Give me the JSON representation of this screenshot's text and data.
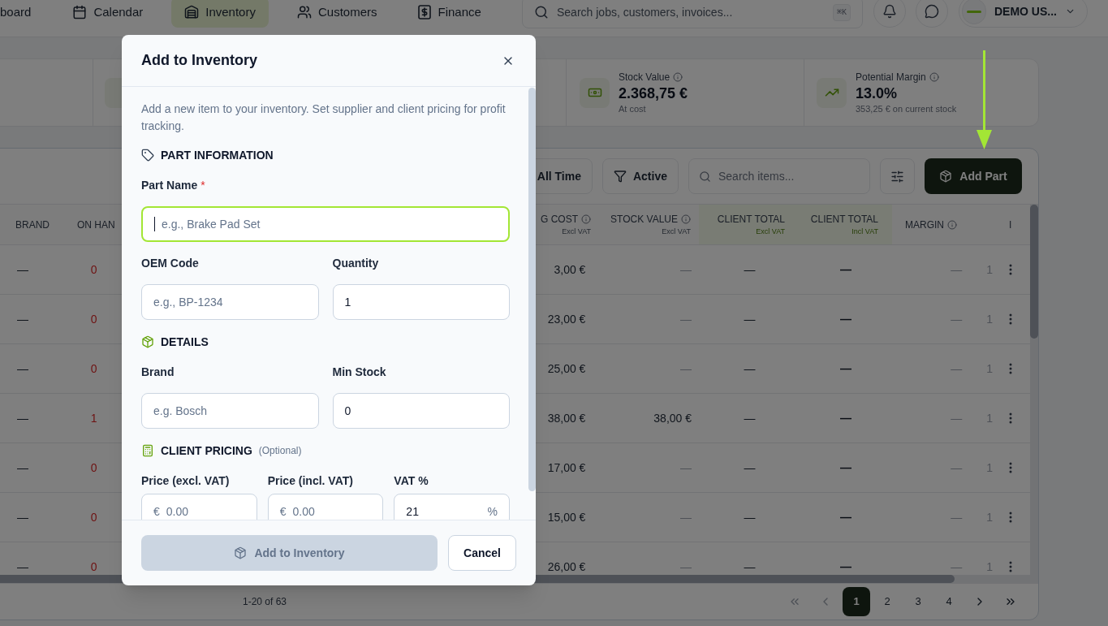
{
  "nav": {
    "tabs": [
      {
        "label": "board",
        "selected": false
      },
      {
        "label": "Calendar",
        "selected": false
      },
      {
        "label": "Inventory",
        "selected": true
      },
      {
        "label": "Customers",
        "selected": false
      },
      {
        "label": "Finance",
        "selected": false
      }
    ],
    "search": {
      "placeholder": "Search jobs, customers, invoices...",
      "shortcut": "⌘K"
    },
    "user": {
      "name": "DEMO US..."
    }
  },
  "stats": [
    {
      "label": "Stock Value",
      "value": "2.368,75 €",
      "note": "At cost"
    },
    {
      "label": "Potential Margin",
      "value": "13.0%",
      "note": "353,25 € on current stock"
    }
  ],
  "toolbar": {
    "period": "All Time",
    "status": "Active",
    "search_placeholder": "Search items...",
    "add_button": "Add Part"
  },
  "table": {
    "columns": [
      {
        "label": "BRAND",
        "info": false
      },
      {
        "label": "ON HAN",
        "info": false
      },
      {
        "label": "G COST",
        "sub": "Excl VAT",
        "info": true
      },
      {
        "label": "STOCK VALUE",
        "sub": "Excl VAT",
        "info": true
      },
      {
        "label": "CLIENT TOTAL",
        "sub": "Excl VAT",
        "info": false
      },
      {
        "label": "CLIENT TOTAL",
        "sub": "Incl VAT",
        "info": false
      },
      {
        "label": "MARGIN",
        "info": true
      },
      {
        "label": "I",
        "info": false
      }
    ],
    "rows": [
      {
        "brand": "—",
        "on_hand": "0",
        "low_stock": true,
        "cost": "3,00 €",
        "stock_value": "—",
        "stock_value_muted": true,
        "client_excl": "—",
        "client_incl": "—",
        "margin": "—",
        "column_9": "1"
      },
      {
        "brand": "—",
        "on_hand": "0",
        "low_stock": true,
        "cost": "23,00 €",
        "stock_value": "—",
        "stock_value_muted": true,
        "client_excl": "—",
        "client_incl": "—",
        "margin": "—",
        "column_9": "1"
      },
      {
        "brand": "—",
        "on_hand": "0",
        "low_stock": true,
        "cost": "25,00 €",
        "stock_value": "—",
        "stock_value_muted": true,
        "client_excl": "—",
        "client_incl": "—",
        "margin": "—",
        "column_9": "1"
      },
      {
        "brand": "—",
        "on_hand": "1",
        "low_stock": true,
        "cost": "38,00 €",
        "stock_value": "38,00 €",
        "stock_value_muted": false,
        "client_excl": "—",
        "client_incl": "—",
        "margin": "—",
        "column_9": "1"
      },
      {
        "brand": "—",
        "on_hand": "0",
        "low_stock": true,
        "cost": "17,00 €",
        "stock_value": "—",
        "stock_value_muted": true,
        "client_excl": "—",
        "client_incl": "—",
        "margin": "—",
        "column_9": "1"
      },
      {
        "brand": "—",
        "on_hand": "0",
        "low_stock": true,
        "cost": "15,00 €",
        "stock_value": "—",
        "stock_value_muted": true,
        "client_excl": "—",
        "client_incl": "—",
        "margin": "—",
        "column_9": "1"
      },
      {
        "brand": "—",
        "on_hand": "0",
        "low_stock": true,
        "cost": "26,00 €",
        "stock_value": "—",
        "stock_value_muted": true,
        "client_excl": "—",
        "client_incl": "—",
        "margin": "—",
        "column_9": "1"
      }
    ]
  },
  "pagination": {
    "range": "1-20 of 63",
    "pages": [
      {
        "label": "1",
        "selected": true
      },
      {
        "label": "2",
        "selected": false
      },
      {
        "label": "3",
        "selected": false
      },
      {
        "label": "4",
        "selected": false
      }
    ]
  },
  "modal": {
    "title": "Add to Inventory",
    "description": "Add a new item to your inventory. Set supplier and client pricing for profit tracking.",
    "sections": [
      {
        "title": "PART INFORMATION",
        "rows": [
          [
            {
              "label": "Part Name",
              "required_mark": "*",
              "placeholder": "e.g., Brake Pad Set",
              "focused": true
            }
          ],
          [
            {
              "label": "OEM Code",
              "placeholder": "e.g., BP-1234",
              "focused": false
            },
            {
              "label": "Quantity",
              "value": "1",
              "focused": false
            }
          ]
        ]
      },
      {
        "title": "DETAILS",
        "rows": [
          [
            {
              "label": "Brand",
              "placeholder": "e.g. Bosch",
              "focused": false
            },
            {
              "label": "Min Stock",
              "value": "0",
              "focused": false
            }
          ]
        ]
      },
      {
        "title": "CLIENT PRICING",
        "note": "(Optional)",
        "rows": [
          [
            {
              "label": "Price (excl. VAT)",
              "prefix": "€",
              "placeholder": "0.00",
              "focused": false
            },
            {
              "label": "Price (incl. VAT)",
              "prefix": "€",
              "placeholder": "0.00",
              "focused": false
            },
            {
              "label": "VAT %",
              "value": "21",
              "suffix": "%",
              "focused": false
            }
          ]
        ]
      }
    ],
    "submit": {
      "label": "Add to Inventory",
      "disabled": true
    },
    "cancel": "Cancel"
  }
}
